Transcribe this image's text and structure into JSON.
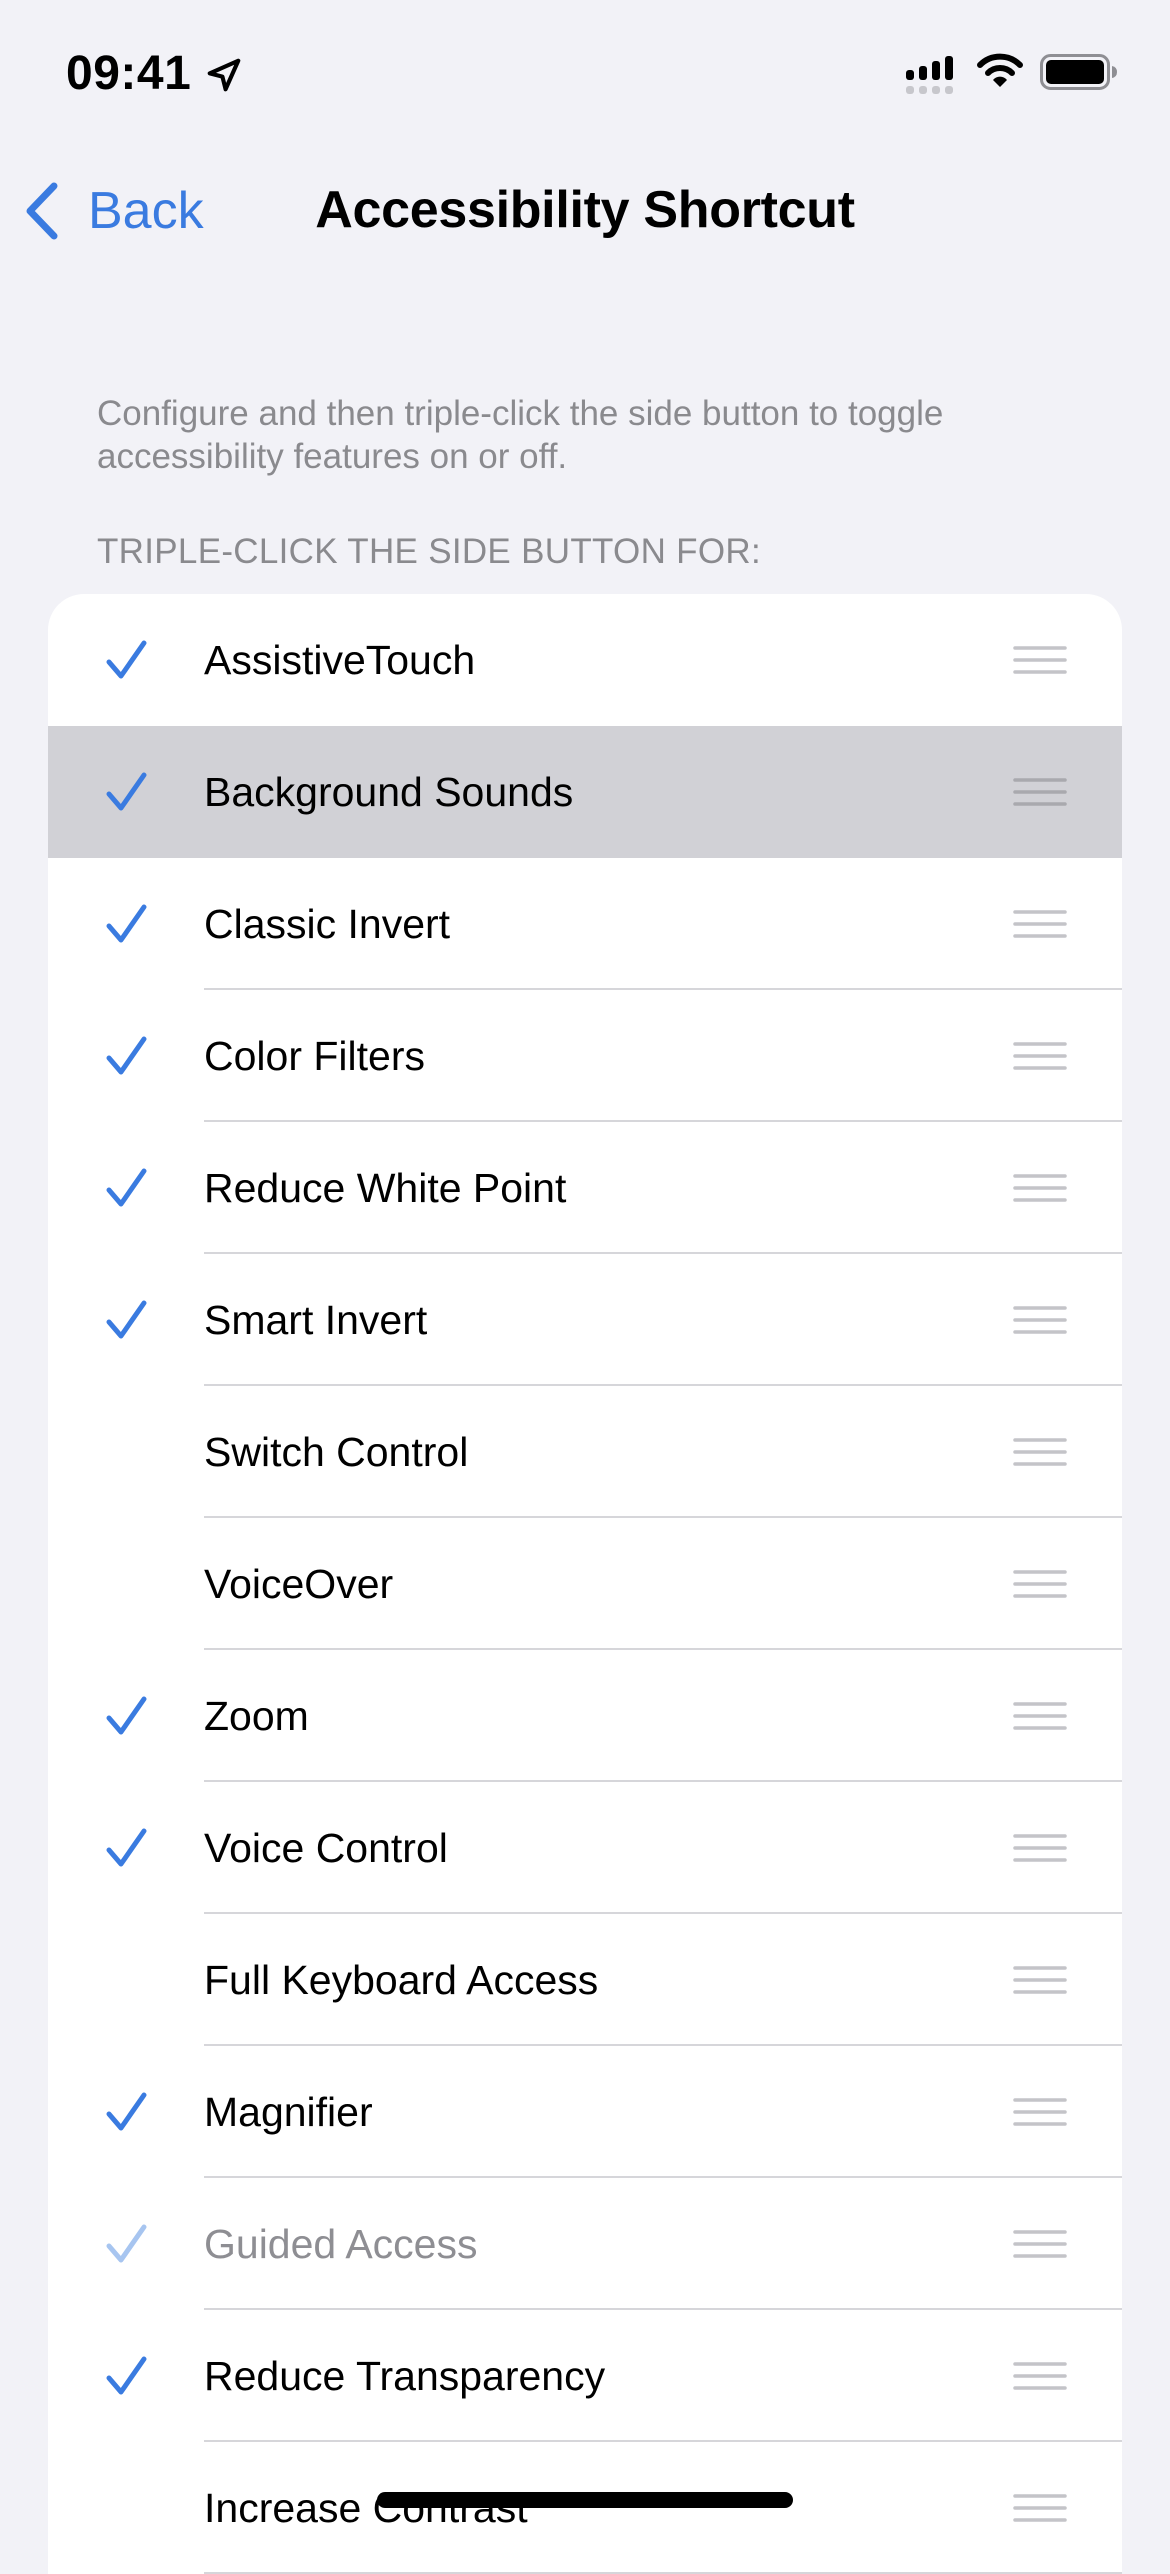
{
  "status_bar": {
    "time": "09:41",
    "icons": [
      "location-arrow-icon",
      "cellular-signal-icon",
      "wifi-icon",
      "battery-icon"
    ]
  },
  "nav": {
    "back_label": "Back",
    "title": "Accessibility Shortcut"
  },
  "description": "Configure and then triple-click the side button to toggle accessibility features on or off.",
  "section_header": "TRIPLE-CLICK THE SIDE BUTTON FOR:",
  "colors": {
    "accent": "#3a7be0",
    "background": "#f2f2f7",
    "highlight_row": "#d1d1d6",
    "secondary_text": "#8a8a8e"
  },
  "features": [
    {
      "label": "AssistiveTouch",
      "checked": true
    },
    {
      "label": "Background Sounds",
      "checked": true,
      "highlighted": true
    },
    {
      "label": "Classic Invert",
      "checked": true
    },
    {
      "label": "Color Filters",
      "checked": true
    },
    {
      "label": "Reduce White Point",
      "checked": true
    },
    {
      "label": "Smart Invert",
      "checked": true
    },
    {
      "label": "Switch Control",
      "checked": false
    },
    {
      "label": "VoiceOver",
      "checked": false
    },
    {
      "label": "Zoom",
      "checked": true
    },
    {
      "label": "Voice Control",
      "checked": true
    },
    {
      "label": "Full Keyboard Access",
      "checked": false
    },
    {
      "label": "Magnifier",
      "checked": true
    },
    {
      "label": "Guided Access",
      "checked": true,
      "dimmed": true
    },
    {
      "label": "Reduce Transparency",
      "checked": true
    },
    {
      "label": "Increase Contrast",
      "checked": false
    }
  ]
}
